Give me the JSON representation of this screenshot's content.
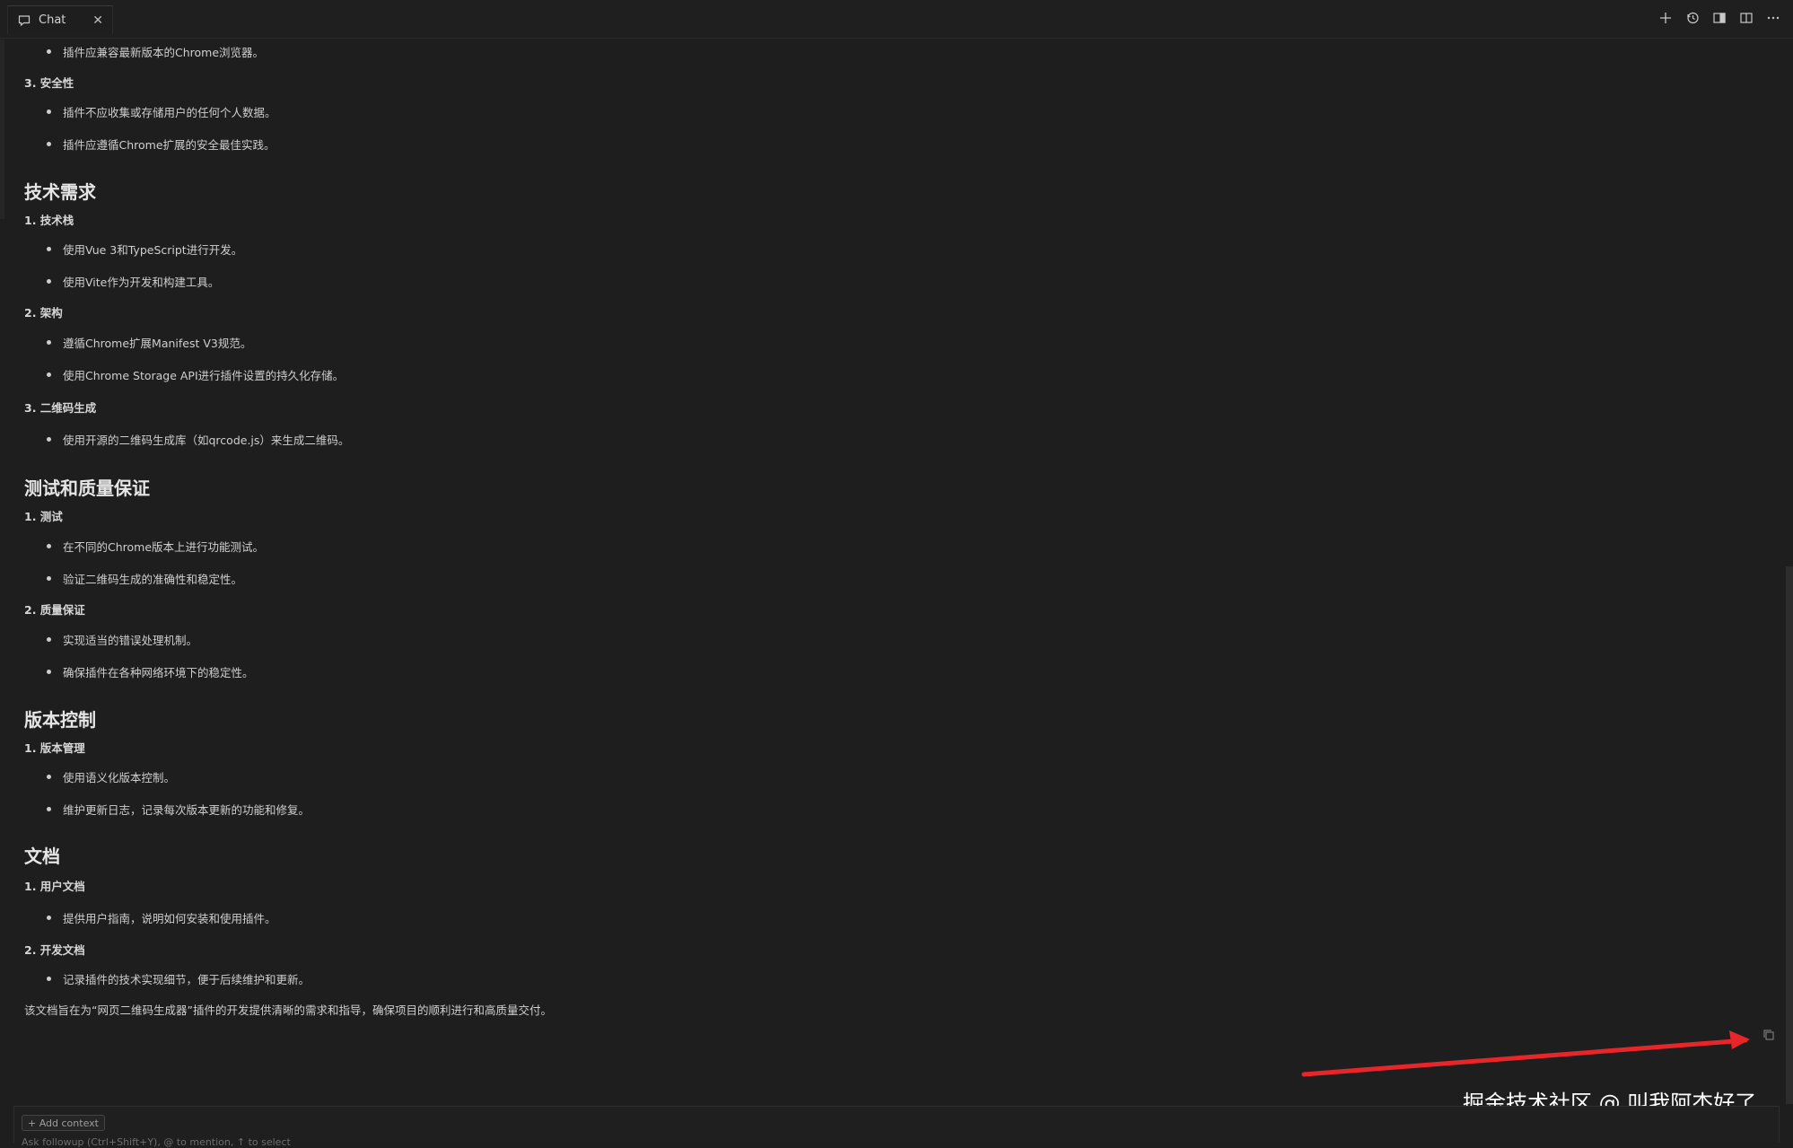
{
  "tab": {
    "title": "Chat",
    "close": "✕"
  },
  "header_actions": [
    {
      "name": "new-chat-icon",
      "glyph": "+"
    },
    {
      "name": "history-icon",
      "glyph": "history"
    },
    {
      "name": "panel-toggle-icon",
      "glyph": "panel"
    },
    {
      "name": "split-panel-icon",
      "glyph": "split"
    },
    {
      "name": "more-icon",
      "glyph": "···"
    }
  ],
  "content": {
    "top_items": [
      {
        "type": "bullet",
        "text": "插件应兼容最新版本的Chrome浏览器。"
      },
      {
        "type": "num",
        "text": "3. 安全性"
      },
      {
        "type": "bullet",
        "text": "插件不应收集或存储用户的任何个人数据。"
      },
      {
        "type": "bullet",
        "text": "插件应遵循Chrome扩展的安全最佳实践。"
      }
    ],
    "sections": [
      {
        "heading": "技术需求",
        "items": [
          {
            "type": "num",
            "text": "1. 技术栈"
          },
          {
            "type": "bullet",
            "text": "使用Vue 3和TypeScript进行开发。"
          },
          {
            "type": "bullet",
            "text": "使用Vite作为开发和构建工具。"
          },
          {
            "type": "num",
            "text": "2. 架构"
          },
          {
            "type": "bullet",
            "text": "遵循Chrome扩展Manifest V3规范。"
          },
          {
            "type": "bullet",
            "text": "使用Chrome Storage API进行插件设置的持久化存储。"
          },
          {
            "type": "num",
            "text": "3. 二维码生成"
          },
          {
            "type": "bullet",
            "text": "使用开源的二维码生成库（如qrcode.js）来生成二维码。"
          }
        ]
      },
      {
        "heading": "测试和质量保证",
        "items": [
          {
            "type": "num",
            "text": "1. 测试"
          },
          {
            "type": "bullet",
            "text": "在不同的Chrome版本上进行功能测试。"
          },
          {
            "type": "bullet",
            "text": "验证二维码生成的准确性和稳定性。"
          },
          {
            "type": "num",
            "text": "2. 质量保证"
          },
          {
            "type": "bullet",
            "text": "实现适当的错误处理机制。"
          },
          {
            "type": "bullet",
            "text": "确保插件在各种网络环境下的稳定性。"
          }
        ]
      },
      {
        "heading": "版本控制",
        "items": [
          {
            "type": "num",
            "text": "1. 版本管理"
          },
          {
            "type": "bullet",
            "text": "使用语义化版本控制。"
          },
          {
            "type": "bullet",
            "text": "维护更新日志，记录每次版本更新的功能和修复。"
          }
        ]
      },
      {
        "heading": "文档",
        "items": [
          {
            "type": "num",
            "text": "1. 用户文档"
          },
          {
            "type": "bullet",
            "text": "提供用户指南，说明如何安装和使用插件。"
          },
          {
            "type": "num",
            "text": "2. 开发文档"
          },
          {
            "type": "bullet",
            "text": "记录插件的技术实现细节，便于后续维护和更新。"
          }
        ]
      }
    ],
    "closing": "该文档旨在为“网页二维码生成器”插件的开发提供清晰的需求和指导，确保项目的顺利进行和高质量交付。"
  },
  "annotation": {
    "arrow_color": "#e8262a"
  },
  "watermark": "掘金技术社区 @ 叫我阿杰好了",
  "input": {
    "add_context": "+ Add context",
    "placeholder": "Ask followup (Ctrl+Shift+Y), @ to mention, ↑ to select"
  }
}
